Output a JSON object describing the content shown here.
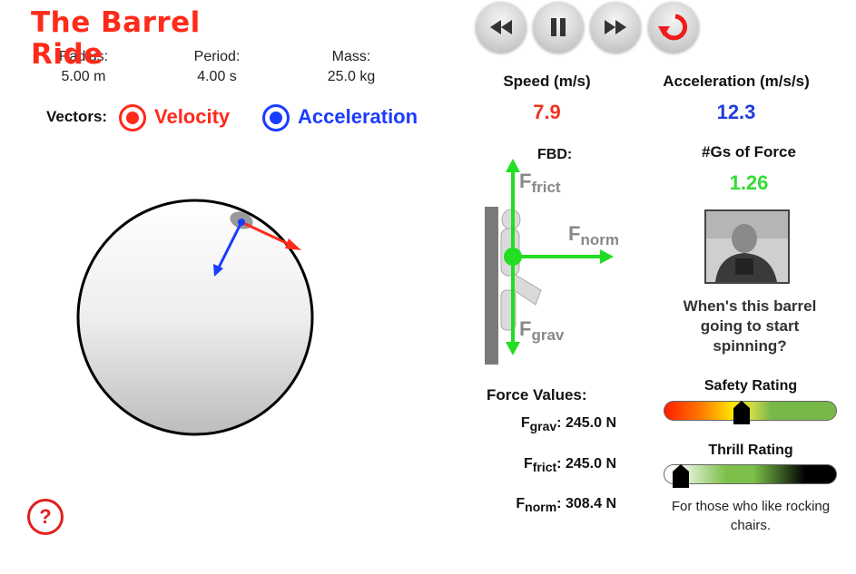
{
  "title": "The Barrel Ride",
  "params": {
    "radius": {
      "label": "Radius:",
      "value": "5.00 m"
    },
    "period": {
      "label": "Period:",
      "value": "4.00 s"
    },
    "mass": {
      "label": "Mass:",
      "value": "25.0 kg"
    }
  },
  "vectors": {
    "label": "Vectors:",
    "velocity": {
      "label": "Velocity",
      "color": "#ff2a1a",
      "selected": true
    },
    "acceleration": {
      "label": "Acceleration",
      "color": "#1a3cff",
      "selected": true
    }
  },
  "controls": {
    "icons": [
      "rewind-icon",
      "pause-icon",
      "fast-forward-icon",
      "reset-icon"
    ],
    "reset_color": "#ee1c1c"
  },
  "stats": {
    "speed": {
      "label": "Speed (m/s)",
      "value": "7.9",
      "color": "#ee3323"
    },
    "acceleration": {
      "label": "Acceleration (m/s/s)",
      "value": "12.3",
      "color": "#1f3ddc"
    },
    "gs": {
      "label": "#Gs of Force",
      "value": "1.26",
      "color": "#33dd33"
    }
  },
  "fbd": {
    "title": "FBD:",
    "arrow_color": "#22dd22",
    "label_color": "#888888",
    "forces": [
      {
        "symbol": "F",
        "sub": "frict"
      },
      {
        "symbol": "F",
        "sub": "norm"
      },
      {
        "symbol": "F",
        "sub": "grav"
      }
    ]
  },
  "question": "When's this barrel going to start spinning?",
  "ratings": {
    "safety": {
      "label": "Safety Rating",
      "level": 0.45
    },
    "thrill": {
      "label": "Thrill Rating",
      "level": 0.1,
      "note": "For those who like rocking chairs."
    }
  },
  "force_values": {
    "title": "Force Values:",
    "rows": [
      {
        "symbol": "F",
        "sub": "grav",
        "value": "245.0 N"
      },
      {
        "symbol": "F",
        "sub": "frict",
        "value": "245.0 N"
      },
      {
        "symbol": "F",
        "sub": "norm",
        "value": "308.4 N"
      }
    ]
  },
  "help": {
    "label": "?",
    "color": "#e02020"
  }
}
